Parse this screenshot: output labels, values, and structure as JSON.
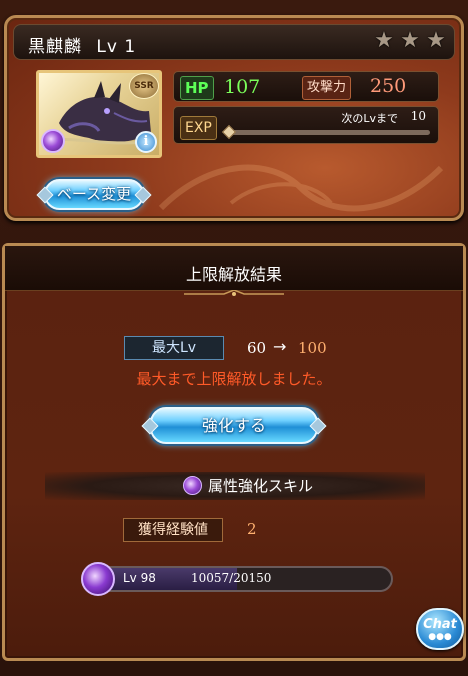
{
  "character": {
    "name": "黒麒麟",
    "level_label": "Lv 1",
    "rarity": "SSR",
    "stars": 3,
    "element_icon": "dark-element-orb-icon",
    "hp_label": "HP",
    "hp_value": "107",
    "atk_label": "攻撃力",
    "atk_value": "250",
    "exp_label": "EXP",
    "next_label": "次のLvまで",
    "next_value": "10",
    "exp_progress": 0.0,
    "info_label": "i"
  },
  "buttons": {
    "change_base": "ベース変更",
    "enhance": "強化する"
  },
  "result": {
    "title": "上限解放結果",
    "max_lv_label": "最大Lv",
    "max_lv_from": "60",
    "arrow": "→",
    "max_lv_to": "100",
    "message": "最大まで上限解放しました。",
    "skill_label": "属性強化スキル",
    "gain_label": "獲得経験値",
    "gain_value": "2",
    "skill_level_label": "Lv 98",
    "skill_exp_text": "10057/20150",
    "skill_exp_progress": 0.499
  },
  "chat": {
    "label": "Chat",
    "dots": "●●●"
  },
  "colors": {
    "panel_border": "#b98a52",
    "hp_green": "#7bff5a",
    "atk_red": "#ff9a7a",
    "message_red": "#ff5a28",
    "value_orange": "#ffb070",
    "button_blue": "#1f8fd6"
  }
}
